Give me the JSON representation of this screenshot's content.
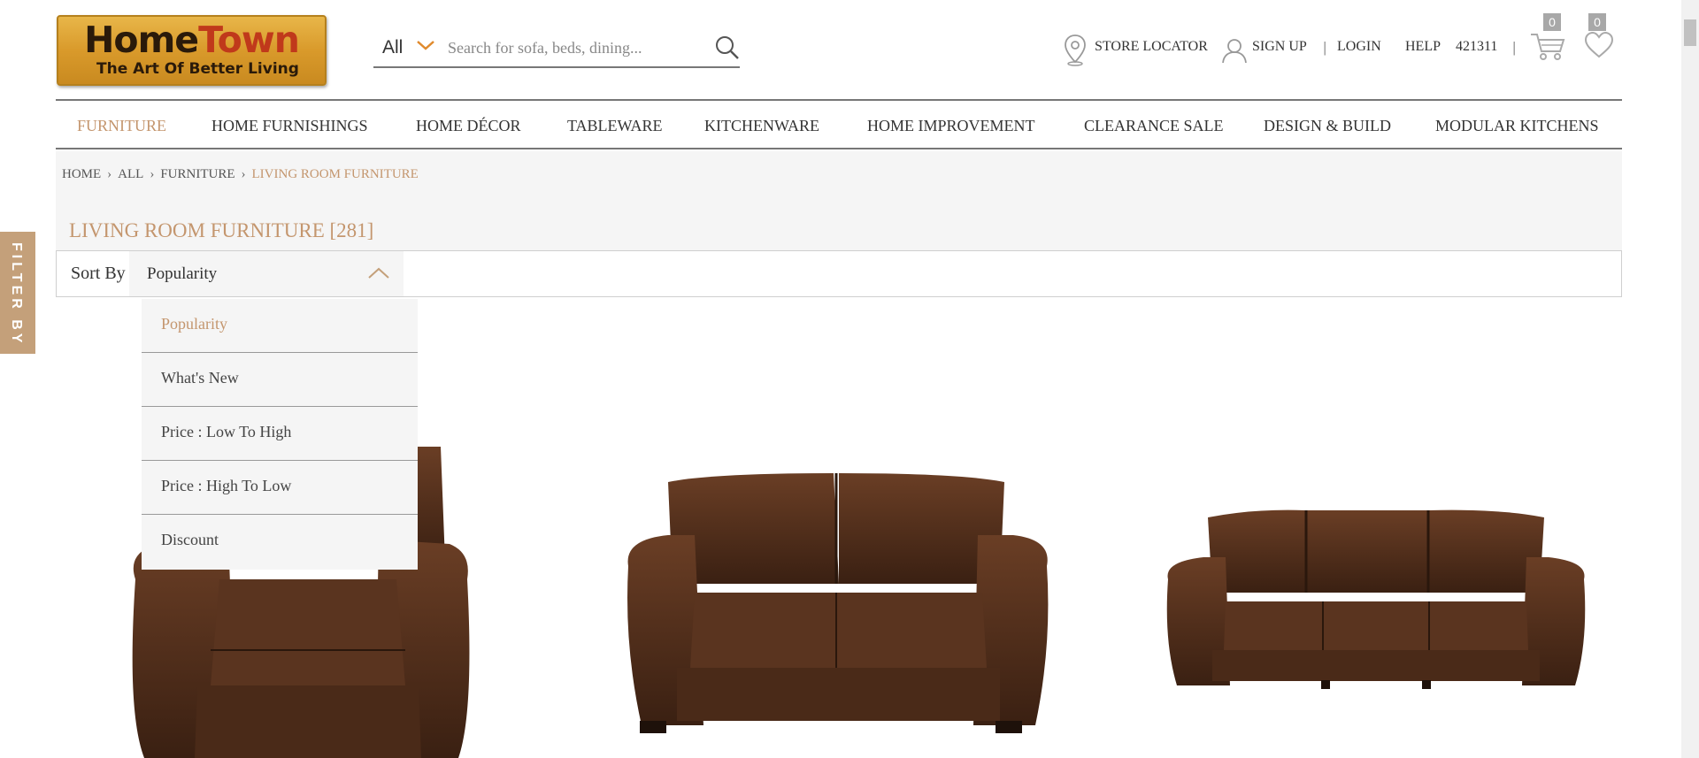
{
  "brand": {
    "line1a": "Home",
    "line1b": "Town",
    "tagline": "The Art Of Better Living"
  },
  "search": {
    "category": "All",
    "placeholder": "Search for sofa, beds, dining..."
  },
  "topnav": {
    "store_locator": "STORE LOCATOR",
    "sign_up": "SIGN UP",
    "login": "LOGIN",
    "help": "HELP",
    "pincode": "421311",
    "cart_count": "0",
    "wishlist_count": "0"
  },
  "menu": [
    "FURNITURE",
    "HOME FURNISHINGS",
    "HOME DÉCOR",
    "TABLEWARE",
    "KITCHENWARE",
    "HOME IMPROVEMENT",
    "CLEARANCE SALE",
    "DESIGN & BUILD",
    "MODULAR KITCHENS"
  ],
  "breadcrumb": [
    "HOME",
    "ALL",
    "FURNITURE",
    "LIVING ROOM FURNITURE"
  ],
  "page_title": "LIVING ROOM FURNITURE [281]",
  "sort": {
    "label": "Sort By",
    "selected": "Popularity",
    "options": [
      "Popularity",
      "What's New",
      "Price : Low To High",
      "Price : High To Low",
      "Discount"
    ]
  },
  "filter_tab": "FILTER BY",
  "colors": {
    "accent": "#c4966e",
    "filter_tab": "#c4a07a",
    "leather": "#4a2a18"
  },
  "products": [
    {
      "icon": "armchair-image"
    },
    {
      "icon": "two-seater-sofa-image"
    },
    {
      "icon": "three-seater-sofa-image"
    }
  ]
}
